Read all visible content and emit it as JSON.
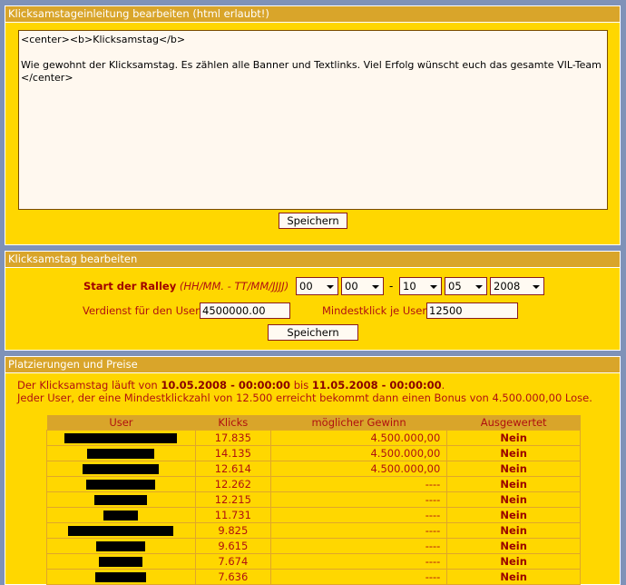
{
  "intro_panel": {
    "title": "Klicksamstageinleitung bearbeiten (html erlaubt!)",
    "editor_text": "<center><b>Klicksamstag</b>\n\nWie gewohnt der Klicksamstag. Es zählen alle Banner und Textlinks. Viel Erfolg wünscht euch das gesamte VIL-Team\n</center>",
    "save_label": "Speichern"
  },
  "edit_panel": {
    "title": "Klicksamstag bearbeiten",
    "start_label": "Start der Ralley",
    "start_format": "(HH/MM. - TT/MM/JJJJ)",
    "hour": "00",
    "minute": "00",
    "separator": "-",
    "day": "10",
    "month": "05",
    "year": "2008",
    "earnings_label": "Verdienst für den User:",
    "earnings_value": "4500000.00",
    "minclick_label": "Mindestklick je User:",
    "minclick_value": "12500",
    "save_label": "Speichern"
  },
  "ranking_panel": {
    "title": "Platzierungen und Preise",
    "line1_prefix": "Der Klicksamstag läuft von",
    "start": "10.05.2008 - 00:00:00",
    "line1_mid": "bis",
    "end": "11.05.2008 - 00:00:00",
    "line1_suffix": ".",
    "line2": "Jeder User, der eine Mindestklickzahl von 12.500 erreicht bekommt dann einen Bonus von 4.500.000,00 Lose.",
    "columns": [
      "User",
      "Klicks",
      "möglicher Gewinn",
      "Ausgewertet"
    ],
    "rows": [
      {
        "clicks": "17.835",
        "prize": "4.500.000,00",
        "evaluated": "Nein"
      },
      {
        "clicks": "14.135",
        "prize": "4.500.000,00",
        "evaluated": "Nein"
      },
      {
        "clicks": "12.614",
        "prize": "4.500.000,00",
        "evaluated": "Nein"
      },
      {
        "clicks": "12.262",
        "prize": "----",
        "evaluated": "Nein"
      },
      {
        "clicks": "12.215",
        "prize": "----",
        "evaluated": "Nein"
      },
      {
        "clicks": "11.731",
        "prize": "----",
        "evaluated": "Nein"
      },
      {
        "clicks": "9.825",
        "prize": "----",
        "evaluated": "Nein"
      },
      {
        "clicks": "9.615",
        "prize": "----",
        "evaluated": "Nein"
      },
      {
        "clicks": "7.674",
        "prize": "----",
        "evaluated": "Nein"
      },
      {
        "clicks": "7.636",
        "prize": "----",
        "evaluated": "Nein"
      }
    ]
  }
}
